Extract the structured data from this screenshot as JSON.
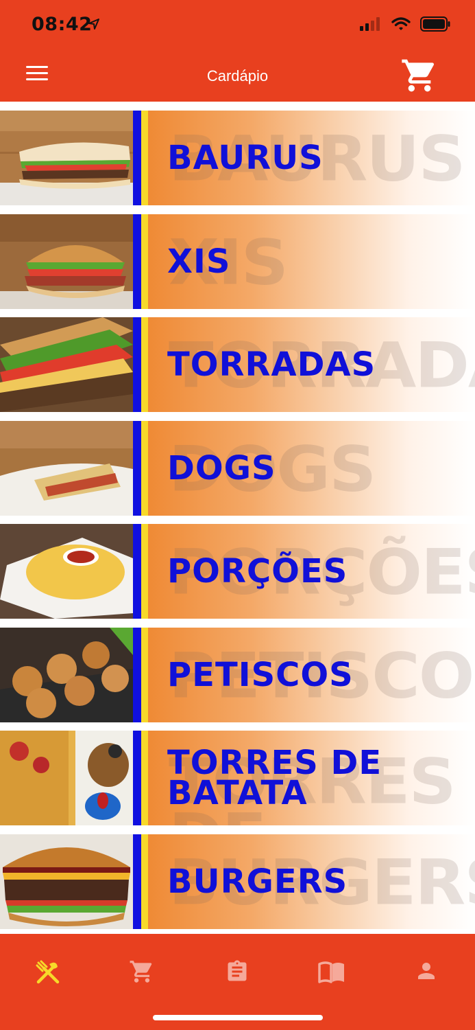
{
  "status_bar": {
    "time": "08:42"
  },
  "header": {
    "title": "Cardápio"
  },
  "categories": [
    {
      "label": "BAURUS",
      "ghost": "BAURUS"
    },
    {
      "label": "XIS",
      "ghost": "XIS"
    },
    {
      "label": "TORRADAS",
      "ghost": "TORRADAS"
    },
    {
      "label": "DOGS",
      "ghost": "DOGS"
    },
    {
      "label": "PORÇÕES",
      "ghost": "PORÇÕES"
    },
    {
      "label": "PETISCOS",
      "ghost": "PETISCOS"
    },
    {
      "label": "TORRES DE BATATA",
      "ghost": "TORRES DE BATATA"
    },
    {
      "label": "BURGERS",
      "ghost": "BURGERS"
    }
  ],
  "bottom_nav": [
    {
      "icon": "fork-knife-icon",
      "active": true
    },
    {
      "icon": "cart-icon",
      "active": false
    },
    {
      "icon": "clipboard-icon",
      "active": false
    },
    {
      "icon": "book-icon",
      "active": false
    },
    {
      "icon": "person-icon",
      "active": false
    }
  ],
  "colors": {
    "brand": "#e8401f",
    "label_blue": "#1010d8",
    "accent_yellow": "#f7d92a",
    "active_nav": "#f7d92a"
  }
}
